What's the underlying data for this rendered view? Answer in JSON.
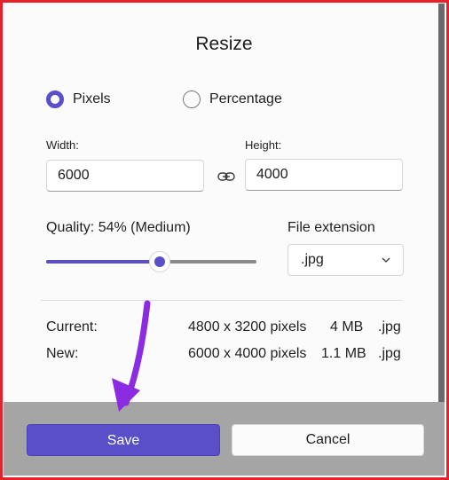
{
  "dialog": {
    "title": "Resize"
  },
  "mode": {
    "options": [
      {
        "label": "Pixels",
        "selected": true
      },
      {
        "label": "Percentage",
        "selected": false
      }
    ]
  },
  "size": {
    "width_label": "Width:",
    "width_value": "6000",
    "height_label": "Height:",
    "height_value": "4000",
    "link_icon": "link-icon"
  },
  "quality": {
    "label": "Quality: 54% (Medium)",
    "value": 0.54
  },
  "file_extension": {
    "label": "File extension",
    "selected": ".jpg",
    "chevron_icon": "chevron-down-icon"
  },
  "info": {
    "current": {
      "label": "Current:",
      "dimensions": "4800 x 3200 pixels",
      "size": "4 MB",
      "ext": ".jpg"
    },
    "new": {
      "label": "New:",
      "dimensions": "6000 x 4000 pixels",
      "size": "1.1 MB",
      "ext": ".jpg"
    }
  },
  "buttons": {
    "save_label": "Save",
    "cancel_label": "Cancel"
  },
  "colors": {
    "accent": "#5a4fc9",
    "border": "#e8202a",
    "arrow": "#8b2be2",
    "footer": "#a5a5a5"
  }
}
